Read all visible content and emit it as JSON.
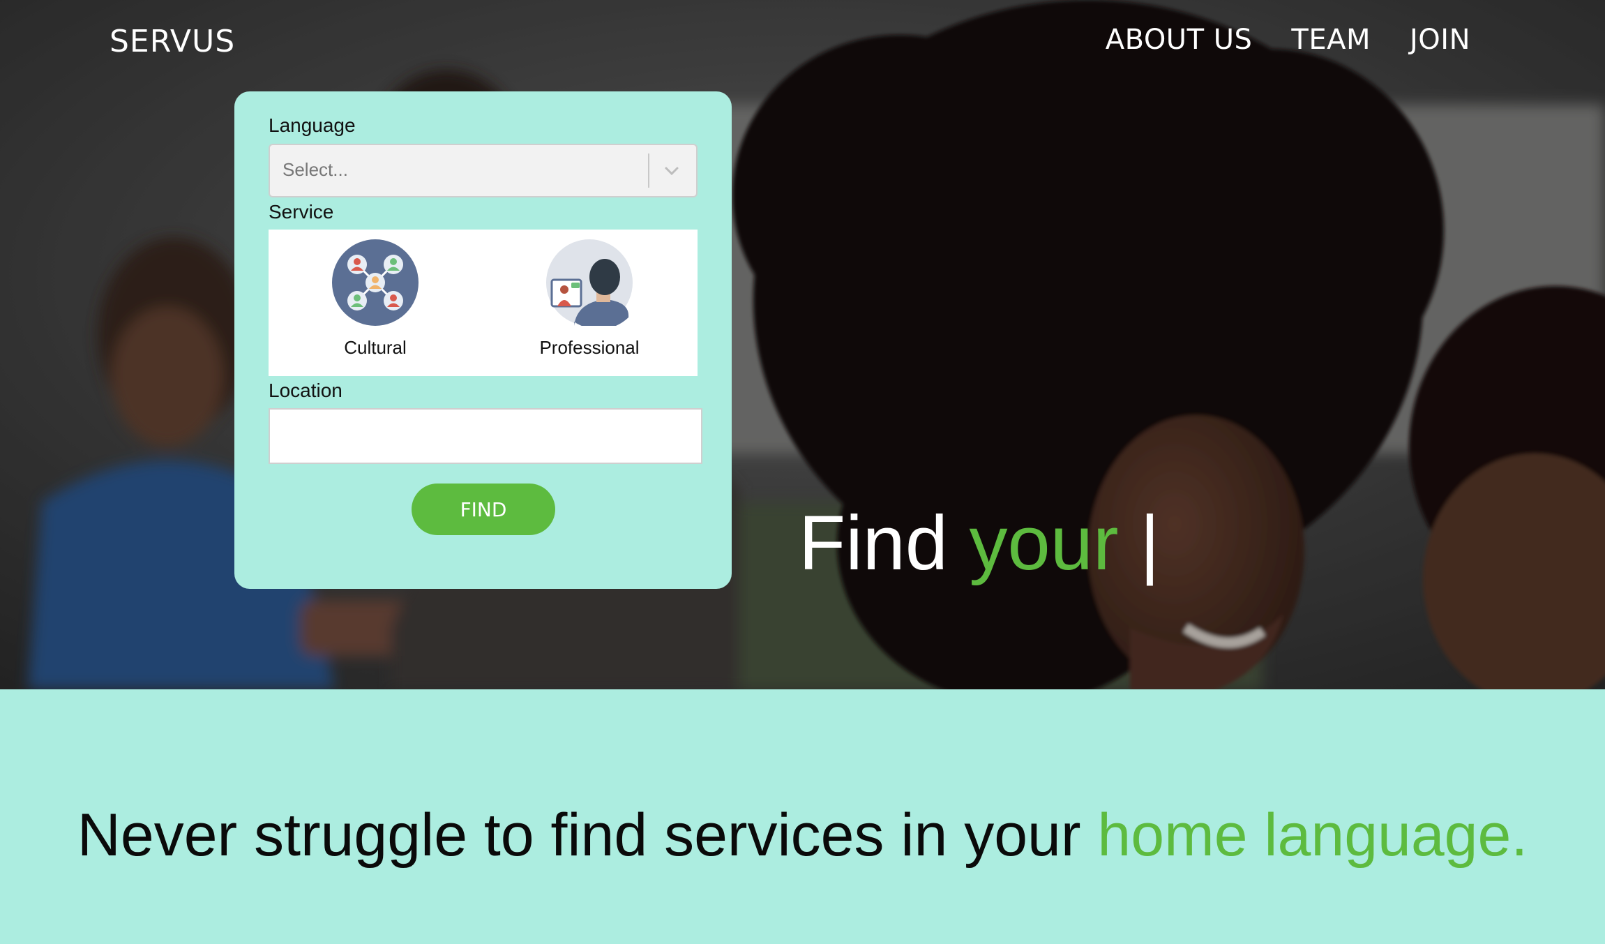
{
  "header": {
    "brand": "SERVUS",
    "nav": [
      {
        "label": "ABOUT US"
      },
      {
        "label": "TEAM"
      },
      {
        "label": "JOIN"
      }
    ]
  },
  "search": {
    "language_label": "Language",
    "language_placeholder": "Select...",
    "service_label": "Service",
    "services": [
      {
        "label": "Cultural",
        "icon": "network-people-icon"
      },
      {
        "label": "Professional",
        "icon": "video-call-icon"
      }
    ],
    "location_label": "Location",
    "location_value": "",
    "find_label": "FIND"
  },
  "hero": {
    "heading_part1": "Find ",
    "heading_accent": "your",
    "heading_cursor": " |"
  },
  "tagline": {
    "text": "Never struggle to find services in your ",
    "accent": "home language."
  },
  "colors": {
    "accent_green": "#5dbb3f",
    "mint": "#acede0",
    "cultural_circle": "#5b6f94",
    "professional_circle": "#dfe3ea"
  }
}
